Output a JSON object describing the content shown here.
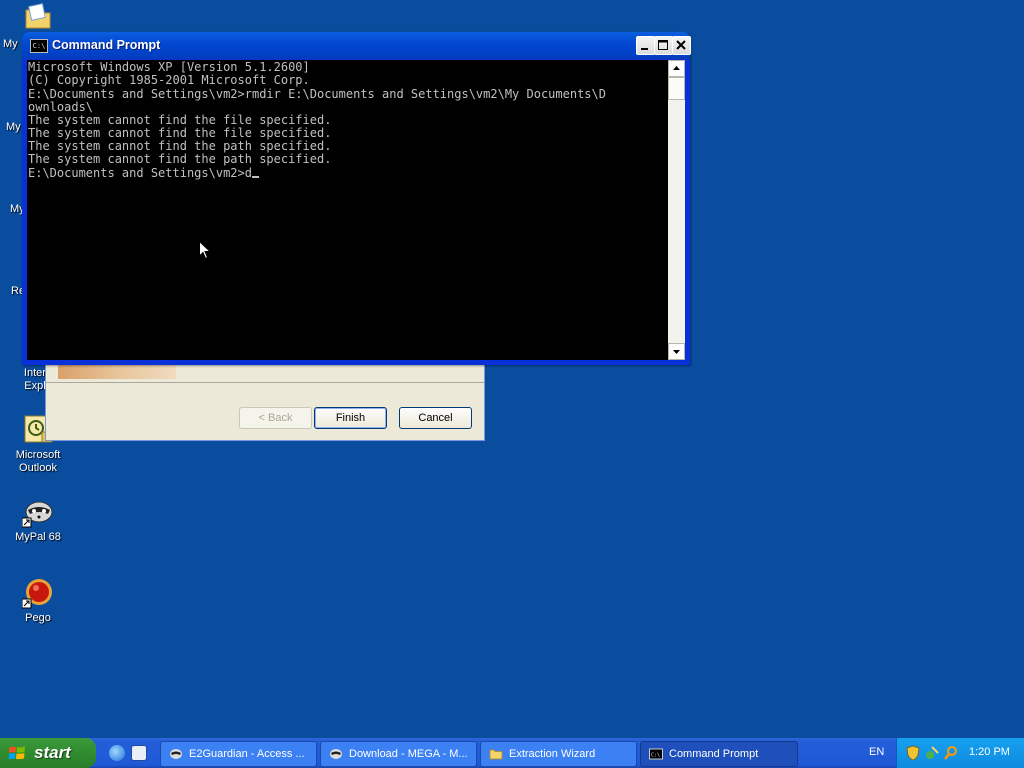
{
  "desktop": {
    "partial_labels": [
      "My",
      "My",
      "My",
      "Re"
    ],
    "icons": [
      {
        "label_line1": "Intern",
        "label_line2": "Explo"
      },
      {
        "label_line1": "Microsoft",
        "label_line2": "Outlook"
      },
      {
        "label_line1": "MyPal 68",
        "label_line2": ""
      },
      {
        "label_line1": "Pego",
        "label_line2": ""
      }
    ]
  },
  "wizard": {
    "back_label": "< Back",
    "finish_label": "Finish",
    "cancel_label": "Cancel"
  },
  "cmd": {
    "title": "Command Prompt",
    "icon_text": "C:\\",
    "lines": [
      "Microsoft Windows XP [Version 5.1.2600]",
      "(C) Copyright 1985-2001 Microsoft Corp.",
      "",
      "E:\\Documents and Settings\\vm2>rmdir E:\\Documents and Settings\\vm2\\My Documents\\D",
      "ownloads\\",
      "The system cannot find the file specified.",
      "The system cannot find the file specified.",
      "The system cannot find the path specified.",
      "The system cannot find the path specified.",
      ""
    ],
    "prompt_line": "E:\\Documents and Settings\\vm2>d"
  },
  "taskbar": {
    "start_label": "start",
    "items": [
      {
        "label": "E2Guardian - Access ..."
      },
      {
        "label": "Download - MEGA - M..."
      },
      {
        "label": "Extraction Wizard"
      },
      {
        "label": "Command Prompt"
      }
    ],
    "language": "EN",
    "clock": "1:20 PM"
  },
  "colors": {
    "desktop": "#0a4d9f",
    "titlebar": "#0348d1",
    "taskbar": "#245edb",
    "start": "#2f8c2f"
  }
}
